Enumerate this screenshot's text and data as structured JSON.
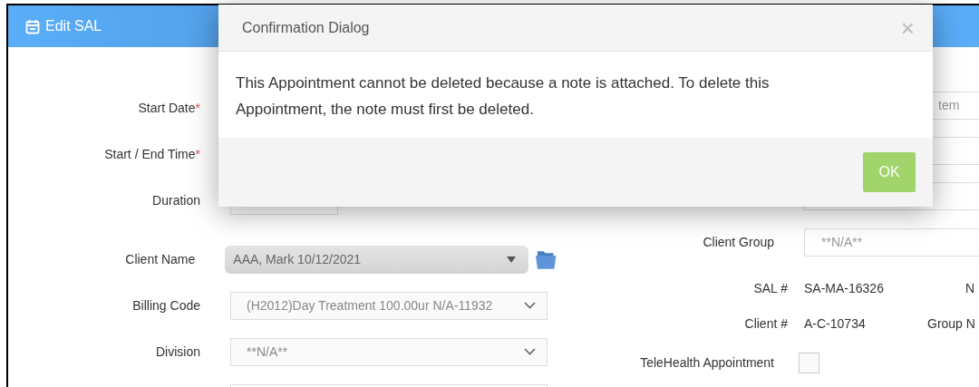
{
  "header": {
    "title": "Edit SAL"
  },
  "left_fields": [
    {
      "kind": "text",
      "label": "Start Date",
      "required_mark": "*"
    },
    {
      "kind": "text",
      "label": "Start / End Time",
      "required_mark": "*"
    },
    {
      "kind": "short",
      "label": "Duration"
    },
    {
      "kind": "combo",
      "label": "Client Name",
      "value": "AAA, Mark 10/12/2021"
    },
    {
      "kind": "select",
      "label": "Billing Code",
      "value": "(H2012)Day Treatment 100.00ur N/A-11932"
    },
    {
      "kind": "select",
      "label": "Division",
      "value": "**N/A**"
    },
    {
      "kind": "text"
    }
  ],
  "right_fields": [
    {
      "kind": "text",
      "value": "tem"
    },
    {
      "kind": "text"
    },
    {
      "kind": "text"
    },
    {
      "kind": "text",
      "label": "Client Group",
      "value": "**N/A**"
    },
    {
      "kind": "info",
      "label": "SAL #",
      "value": "SA-MA-16326",
      "extra_label": "N"
    },
    {
      "kind": "info",
      "label": "Client #",
      "value": "A-C-10734",
      "extra_label": "Group N"
    },
    {
      "kind": "checkbox",
      "label": "TeleHealth Appointment",
      "checked": false
    }
  ],
  "dialog": {
    "title": "Confirmation Dialog",
    "close": "×",
    "message": "This Appointment cannot be deleted because a note is attached. To delete this Appointment, the note must first be deleted.",
    "buttons": [
      {
        "label": "OK"
      }
    ]
  }
}
